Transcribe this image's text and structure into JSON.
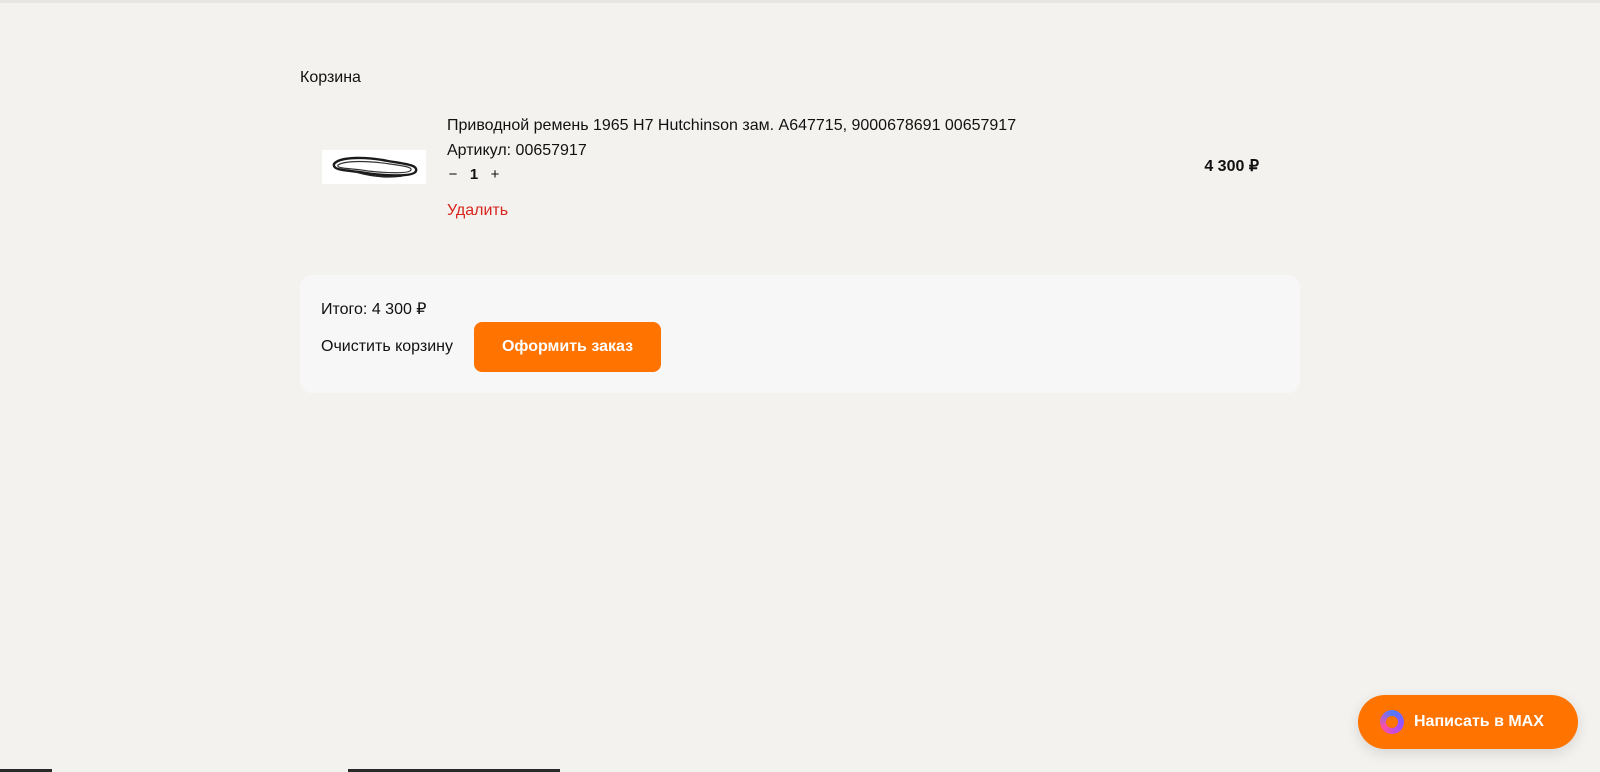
{
  "page": {
    "title": "Корзина"
  },
  "cart": {
    "items": [
      {
        "name": "Приводной ремень 1965 H7 Hutchinson зам. A647715, 9000678691 00657917",
        "sku_label": "Артикул: 00657917",
        "quantity": "1",
        "decrement": "−",
        "increment": "+",
        "remove_label": "Удалить",
        "price": "4 300 ₽",
        "image_icon": "drive-belt-icon"
      }
    ]
  },
  "summary": {
    "total": "Итого: 4 300 ₽",
    "clear_label": "Очистить корзину",
    "checkout_label": "Оформить заказ"
  },
  "chat": {
    "label": "Написать в MAX",
    "icon": "max-messenger-icon"
  },
  "colors": {
    "accent": "#ff7300",
    "danger": "#d9251d",
    "background": "#f4f2ef"
  }
}
